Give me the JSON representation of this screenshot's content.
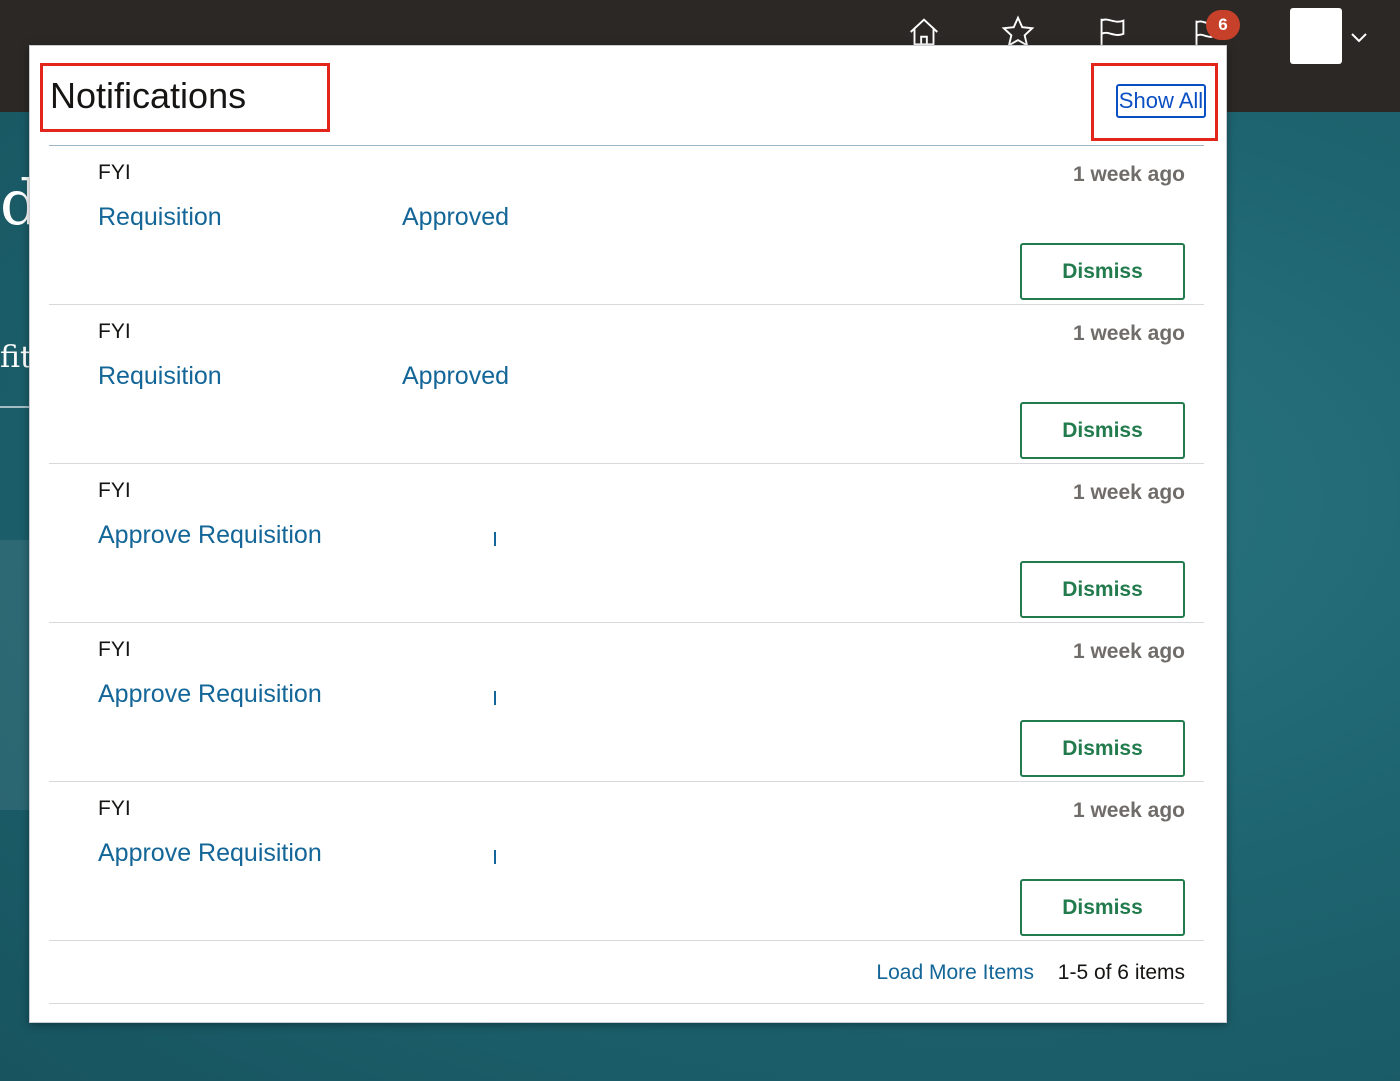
{
  "colors": {
    "topbar": "#2b2826",
    "background": "#1f6470",
    "link": "#136697",
    "dismiss": "#227b4d",
    "highlight": "#e3261c",
    "badge": "#c7402a"
  },
  "background_page": {
    "fragment_1": "d",
    "fragment_2": "fit"
  },
  "topbar": {
    "icons": [
      "home-icon",
      "star-icon",
      "flag-icon",
      "notifications-icon"
    ],
    "notification_count": "6"
  },
  "popup": {
    "title": "Notifications",
    "show_all": "Show All",
    "items": [
      {
        "type": "FYI",
        "time": "1 week ago",
        "link": "Requisition",
        "status": "Approved",
        "dismiss": "Dismiss"
      },
      {
        "type": "FYI",
        "time": "1 week ago",
        "link": "Requisition",
        "status": "Approved",
        "dismiss": "Dismiss"
      },
      {
        "type": "FYI",
        "time": "1 week ago",
        "link": "Approve Requisition",
        "status": "",
        "dismiss": "Dismiss"
      },
      {
        "type": "FYI",
        "time": "1 week ago",
        "link": "Approve Requisition",
        "status": "",
        "dismiss": "Dismiss"
      },
      {
        "type": "FYI",
        "time": "1 week ago",
        "link": "Approve Requisition",
        "status": "",
        "dismiss": "Dismiss"
      }
    ],
    "footer": {
      "load_more": "Load More Items",
      "range": "1-5 of 6 items"
    }
  }
}
